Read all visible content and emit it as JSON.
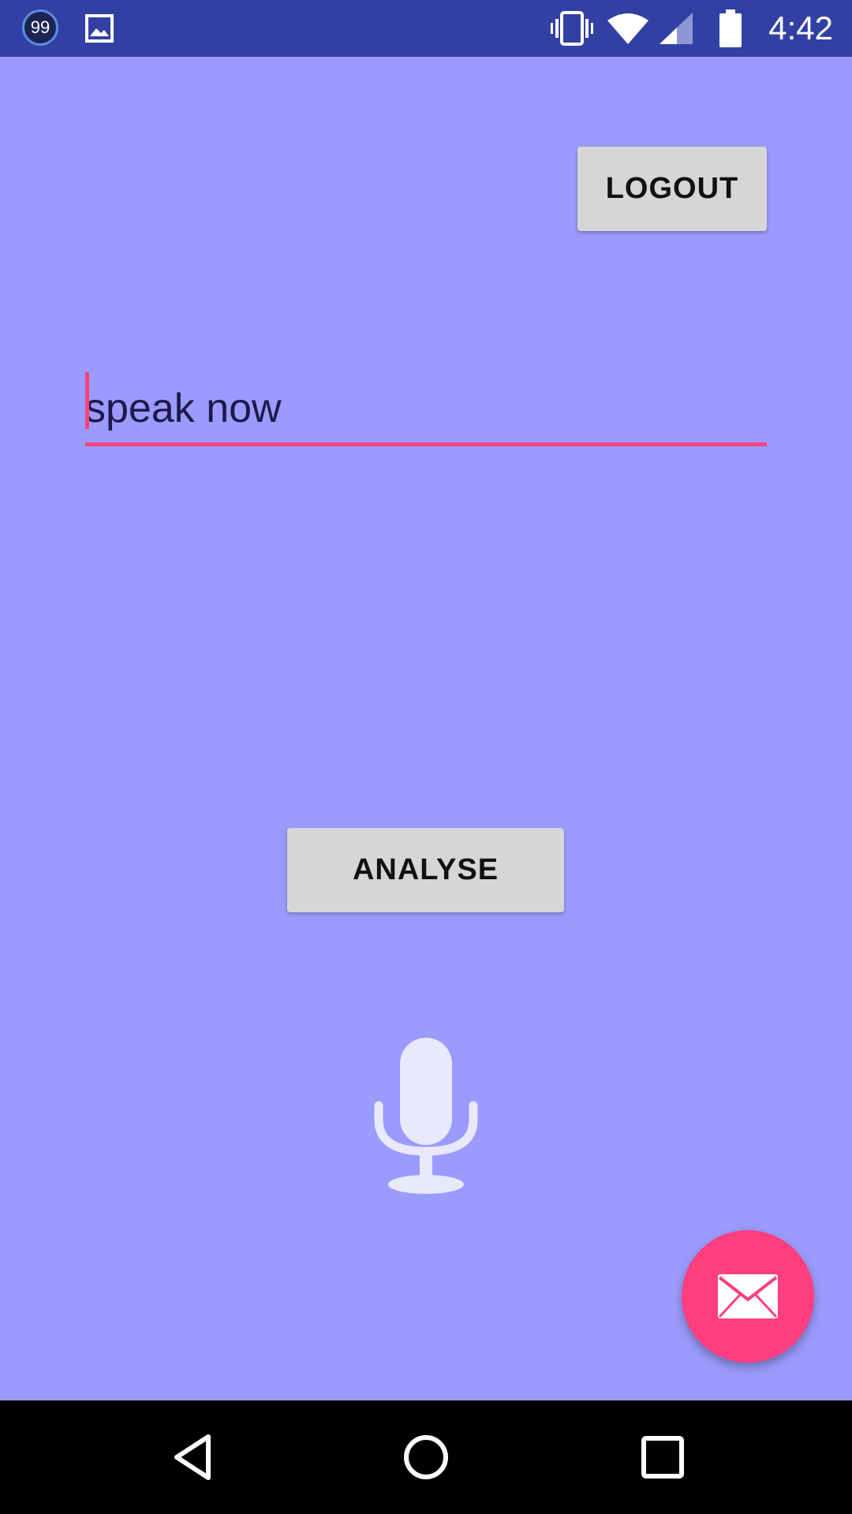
{
  "status_bar": {
    "notification_badge": "99",
    "icons": [
      "notification-count-icon",
      "image-icon",
      "vibrate-icon",
      "wifi-icon",
      "cell-signal-icon",
      "battery-icon"
    ],
    "time": "4:42",
    "background_color": "#3340a3"
  },
  "header": {
    "logout_label": "LOGOUT"
  },
  "speech_input": {
    "value": "speak now",
    "accent_color": "#f2457f"
  },
  "actions": {
    "analyse_label": "ANALYSE"
  },
  "mic": {
    "icon": "microphone-icon"
  },
  "fab": {
    "icon": "mail-icon",
    "color": "#fd3f80"
  },
  "navigation_bar": {
    "icons": [
      "back-icon",
      "home-icon",
      "recents-icon"
    ]
  },
  "theme": {
    "background": "#9b9bfd"
  }
}
